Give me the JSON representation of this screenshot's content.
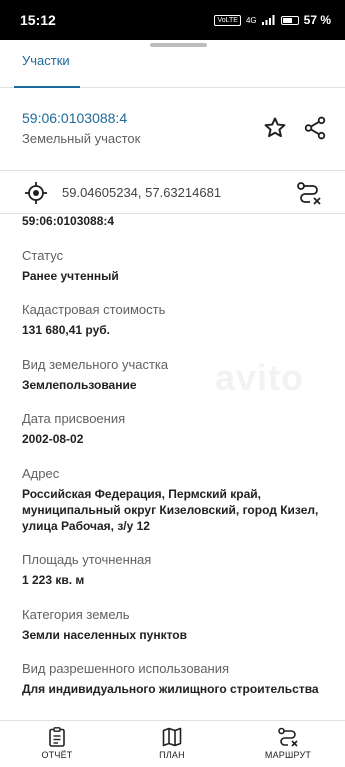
{
  "status_bar": {
    "time": "15:12",
    "volte": "VoLTE",
    "network": "4G",
    "battery_percent": "57 %",
    "battery_level": 0.57
  },
  "tabs": [
    {
      "label": "Участки",
      "active": true
    }
  ],
  "header": {
    "cadastral_number": "59:06:0103088:4",
    "object_type": "Земельный участок"
  },
  "coordinates": "59.04605234, 57.63214681",
  "details": {
    "partial_number": "59:06:0103088:4",
    "fields": [
      {
        "label": "Статус",
        "value": "Ранее учтенный"
      },
      {
        "label": "Кадастровая стоимость",
        "value": "131 680,41 руб."
      },
      {
        "label": "Вид земельного участка",
        "value": "Землепользование"
      },
      {
        "label": "Дата присвоения",
        "value": "2002-08-02"
      },
      {
        "label": "Адрес",
        "value": "Российская Федерация, Пермский край, муниципальный округ Кизеловский, город Кизел, улица Рабочая, з/у 12"
      },
      {
        "label": "Площадь уточненная",
        "value": "1 223 кв. м"
      },
      {
        "label": "Категория земель",
        "value": "Земли населенных пунктов"
      },
      {
        "label": "Вид разрешенного использования",
        "value": "Для индивидуального жилищного строительства"
      }
    ]
  },
  "watermark": "avito",
  "bottom_nav": [
    {
      "label": "ОТЧЁТ",
      "icon": "report-icon"
    },
    {
      "label": "ПЛАН",
      "icon": "map-icon"
    },
    {
      "label": "МАРШРУТ",
      "icon": "route-icon"
    }
  ],
  "colors": {
    "accent": "#1e6a9c",
    "text": "#212121",
    "secondary": "#616161",
    "divider": "#e0e0e0"
  }
}
